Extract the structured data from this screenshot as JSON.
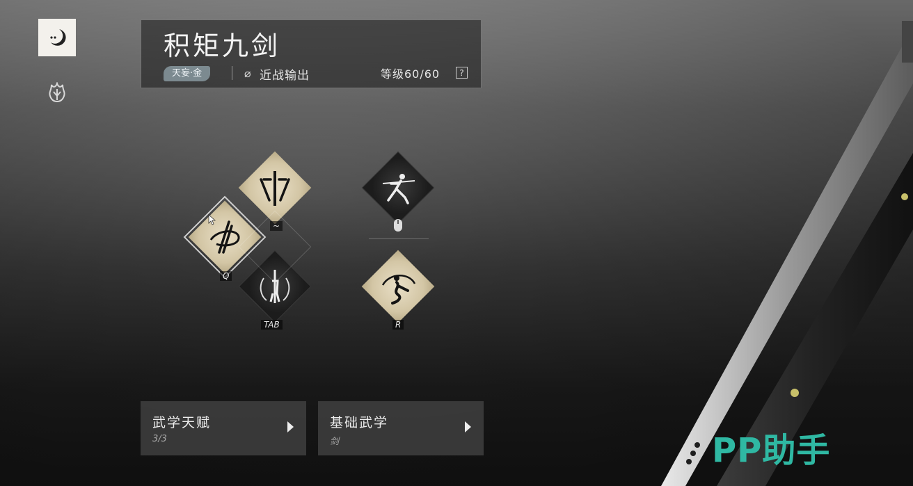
{
  "skill_set": {
    "title": "积矩九剑",
    "element_badge": "天妄·金",
    "style_icon": "slash-circle-icon",
    "style": "近战输出",
    "level": "等级60/60",
    "help": "?"
  },
  "skills": [
    {
      "id": "q",
      "key": "Q",
      "icon": "sword-slash-icon",
      "state": "selected"
    },
    {
      "id": "tilde",
      "key": "~",
      "icon": "sword-fan-icon",
      "state": "active"
    },
    {
      "id": "tab",
      "key": "TAB",
      "icon": "spinning-sword-figure-icon",
      "state": "inactive"
    },
    {
      "id": "mouse",
      "key": "",
      "icon": "lunging-figure-icon",
      "key_icon": "mouse-icon",
      "state": "inactive"
    },
    {
      "id": "r",
      "key": "R",
      "icon": "whirl-figure-icon",
      "state": "active"
    }
  ],
  "cards": [
    {
      "title": "武学天赋",
      "subtitle": "3/3"
    },
    {
      "title": "基础武学",
      "subtitle": "剑"
    }
  ],
  "watermark": "PP助手",
  "colors": {
    "gold": "#d3c6a5",
    "badge": "#7c8a90",
    "watermark": "#2fb8a3"
  }
}
